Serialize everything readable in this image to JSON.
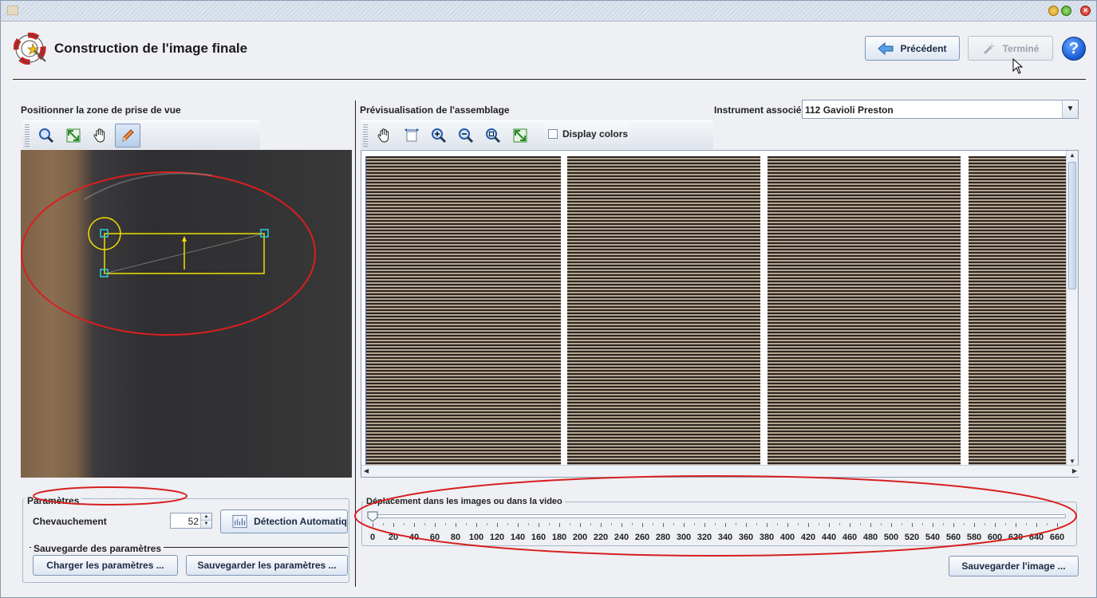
{
  "window": {
    "title": ""
  },
  "header": {
    "title": "Construction de l'image finale",
    "prev_label": "Précédent",
    "done_label": "Terminé",
    "help_label": "?"
  },
  "left_panel": {
    "title": "Positionner la zone de prise de vue",
    "tools": [
      "zoom-icon",
      "fit-icon",
      "pan-icon",
      "pencil-icon"
    ],
    "parameters": {
      "group_title": "Paramètres",
      "overlap_label": "Chevauchement",
      "overlap_value": "52",
      "auto_detect_label": "Détection Automatiq",
      "save_group_title": "Sauvegarde des paramètres",
      "load_button": "Charger les paramètres ...",
      "save_button": "Sauvegarder les paramètres ..."
    }
  },
  "right_panel": {
    "title": "Prévisualisation de l'assemblage",
    "instrument_label": "Instrument associé",
    "instrument_value": "112 Gavioli Preston",
    "tools": [
      "pan-icon",
      "fit-width-icon",
      "zoom-in-icon",
      "zoom-out-icon",
      "zoom-icon",
      "fit-icon"
    ],
    "display_colors_label": "Display colors",
    "display_colors_checked": false,
    "slider": {
      "title": "Déplacement dans les images ou dans la video",
      "value": 0,
      "ticks": [
        "0",
        "20",
        "40",
        "60",
        "80",
        "100",
        "120",
        "140",
        "160",
        "180",
        "200",
        "220",
        "240",
        "260",
        "280",
        "300",
        "320",
        "340",
        "360",
        "380",
        "400",
        "420",
        "440",
        "460",
        "480",
        "500",
        "520",
        "540",
        "560",
        "580",
        "600",
        "620",
        "640",
        "660"
      ]
    },
    "save_image_button": "Sauvegarder l'image ..."
  },
  "colors": {
    "accent": "#7d95b8",
    "annotation": "#d81f1f",
    "selection": "#f0e000"
  }
}
